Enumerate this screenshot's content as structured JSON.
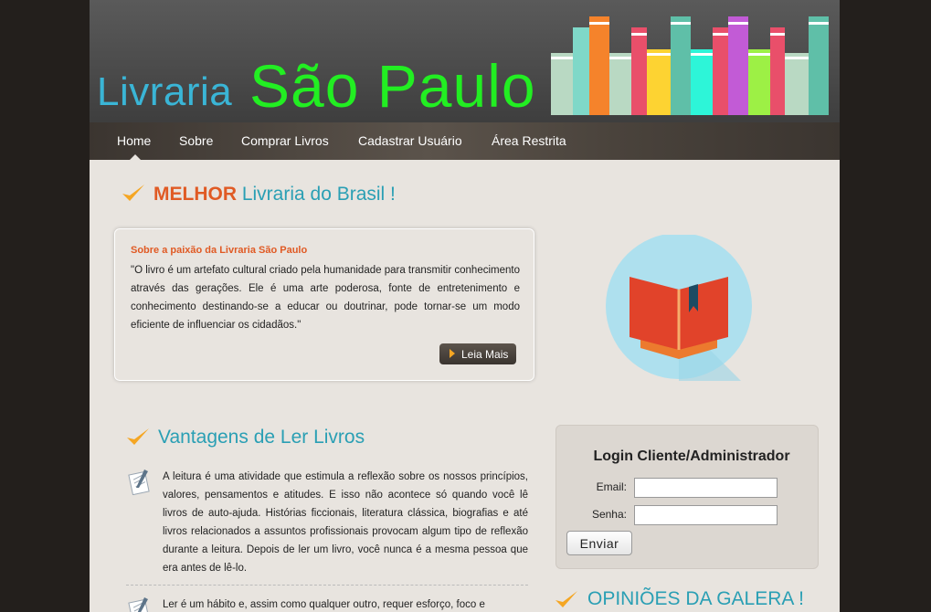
{
  "header": {
    "logo_part1": "Livraria",
    "logo_part2": "São Paulo",
    "colors": {
      "logo_part1": "#3ab5d6",
      "logo_part2": "#22ee22"
    }
  },
  "nav": {
    "items": [
      {
        "label": "Home",
        "active": true
      },
      {
        "label": "Sobre"
      },
      {
        "label": "Comprar Livros"
      },
      {
        "label": "Cadastrar Usuário"
      },
      {
        "label": "Área Restrita"
      }
    ]
  },
  "intro": {
    "heading_strong": "MELHOR",
    "heading_rest": " Livraria do Brasil !",
    "about_title": "Sobre a paixão da Livraria São Paulo",
    "about_text": "\"O livro é um artefato cultural criado pela humanidade para transmitir conhecimento através das gerações. Ele é uma arte poderosa, fonte de entretenimento e conhecimento destinando-se a educar ou doutrinar, pode tornar-se um modo eficiente de influenciar os cidadãos.\"",
    "read_more": "Leia Mais"
  },
  "advantages": {
    "heading": "Vantagens de Ler Livros",
    "items": [
      {
        "text": "A leitura é uma atividade que estimula a reflexão sobre os nossos princípios, valores, pensamentos e atitudes. E isso não acontece só quando você lê livros de auto-ajuda. Histórias ficcionais, literatura clássica, biografias e até livros relacionados a assuntos profissionais provocam algum tipo de reflexão durante a leitura. Depois de ler um livro, você nunca é a mesma pessoa que era antes de lê-lo."
      },
      {
        "text": "Ler é um hábito e, assim como qualquer outro, requer esforço, foco e"
      }
    ]
  },
  "login": {
    "title": "Login Cliente/Administrador",
    "email_label": "Email:",
    "password_label": "Senha:",
    "email_value": "",
    "password_value": "",
    "submit": "Enviar"
  },
  "opinions": {
    "heading": "OPINIÕES DA GALERA !"
  },
  "icons": {
    "check": "checkmark-icon",
    "book": "open-book-icon",
    "doc": "document-pen-icon",
    "arrow": "play-arrow-icon"
  }
}
